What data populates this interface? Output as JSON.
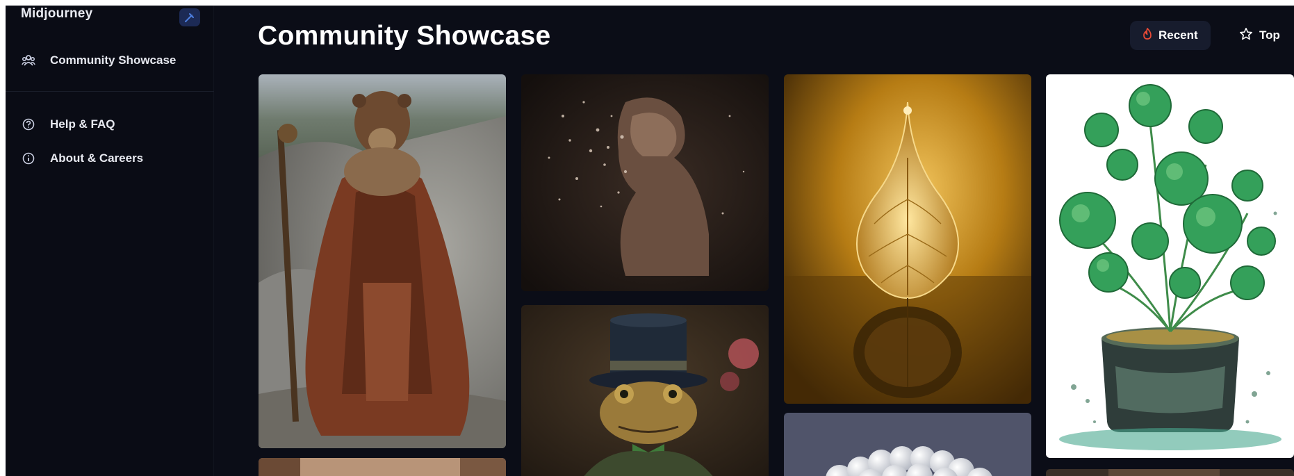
{
  "app": {
    "brand": "Midjourney"
  },
  "sidebar": {
    "items": [
      {
        "label": "Community Showcase",
        "icon": "users-icon"
      },
      {
        "label": "Help & FAQ",
        "icon": "help-circle-icon"
      },
      {
        "label": "About & Careers",
        "icon": "info-circle-icon"
      }
    ]
  },
  "header": {
    "title": "Community Showcase",
    "sort": {
      "recent_label": "Recent",
      "top_label": "Top",
      "selected": "Recent"
    }
  },
  "gallery": {
    "images": [
      {
        "subject": "bear-druid-image"
      },
      {
        "subject": "particle-bust-image"
      },
      {
        "subject": "golden-leaf-drop-image"
      },
      {
        "subject": "pennywort-plant-pot-image"
      },
      {
        "subject": "top-hat-frog-portrait-image"
      },
      {
        "subject": "white-spheres-image"
      },
      {
        "subject": "portrait-partial-image"
      },
      {
        "subject": "partial-image"
      }
    ]
  },
  "colors": {
    "background": "#0b0d17",
    "accent_recent": "#e84a36",
    "button_bg": "#171c2d"
  }
}
